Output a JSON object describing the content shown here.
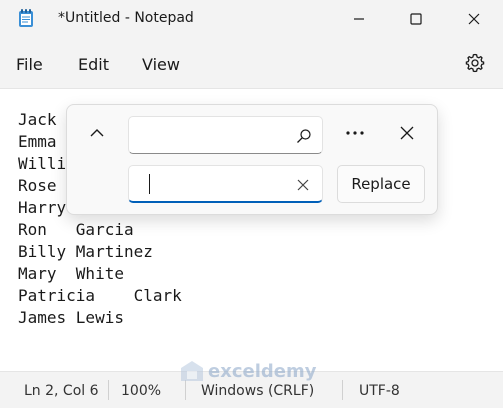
{
  "window": {
    "title": "*Untitled - Notepad",
    "icon": "notepad-icon",
    "controls": [
      "minimize-icon",
      "maximize-icon",
      "close-icon"
    ]
  },
  "menu": {
    "items": [
      {
        "label": "File"
      },
      {
        "label": "Edit"
      },
      {
        "label": "View"
      }
    ],
    "settings_icon": "gear-icon"
  },
  "editor": {
    "lines": [
      "Jack",
      "Emma",
      "Willi",
      "Rose",
      "Harry",
      "Ron   Garcia",
      "Billy Martinez",
      "Mary  White",
      "Patricia    Clark",
      "James Lewis"
    ]
  },
  "find_replace": {
    "find_value": "",
    "replace_value": "",
    "replace_label": "Replace",
    "icons": [
      "chevron-up-icon",
      "search-icon",
      "more-icon",
      "close-icon",
      "clear-icon"
    ]
  },
  "status": {
    "position": "Ln 2, Col 6",
    "zoom": "100%",
    "line_ending": "Windows (CRLF)",
    "encoding": "UTF-8"
  },
  "watermark": {
    "text": "exceldemy"
  },
  "colors": {
    "accent": "#005fb8",
    "background": "#f3f3f3",
    "editor": "#ffffff"
  }
}
